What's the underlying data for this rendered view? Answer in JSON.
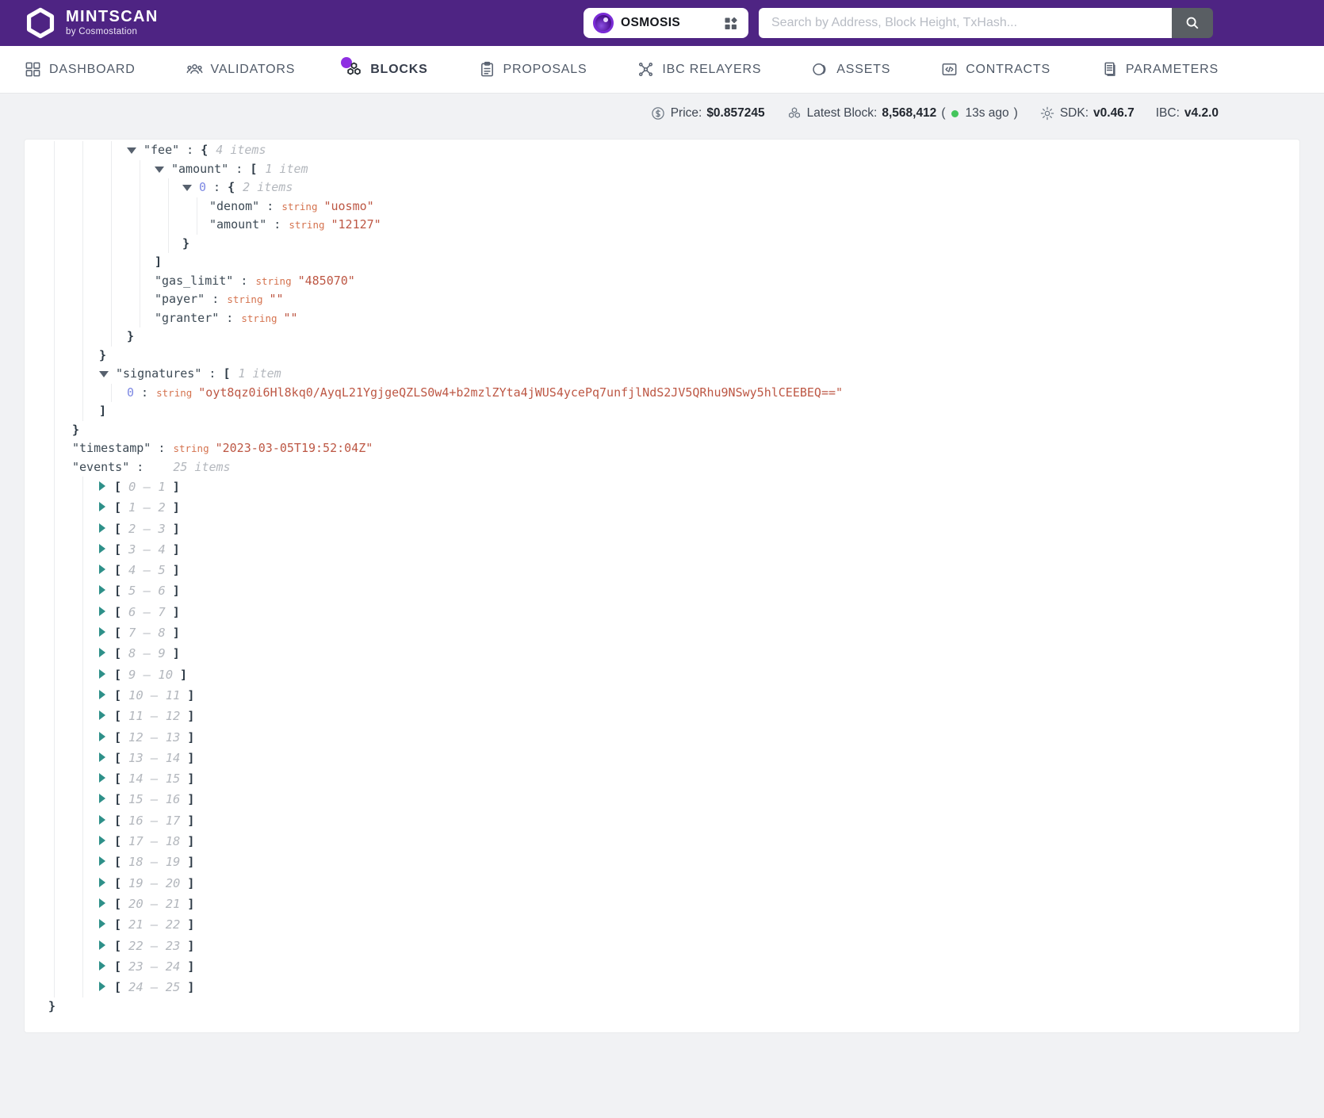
{
  "header": {
    "brand": {
      "title": "MINTSCAN",
      "subtitle": "by Cosmostation"
    },
    "chain_selector": {
      "label": "OSMOSIS"
    },
    "search": {
      "placeholder": "Search by Address, Block Height, TxHash..."
    }
  },
  "nav": {
    "items": [
      {
        "label": "DASHBOARD",
        "icon": "dashboard-icon",
        "active": false
      },
      {
        "label": "VALIDATORS",
        "icon": "validators-icon",
        "active": false
      },
      {
        "label": "BLOCKS",
        "icon": "blocks-icon",
        "active": true,
        "badge": true
      },
      {
        "label": "PROPOSALS",
        "icon": "proposals-icon",
        "active": false
      },
      {
        "label": "IBC RELAYERS",
        "icon": "ibc-relayers-icon",
        "active": false
      },
      {
        "label": "ASSETS",
        "icon": "assets-icon",
        "active": false
      },
      {
        "label": "CONTRACTS",
        "icon": "contracts-icon",
        "active": false
      },
      {
        "label": "PARAMETERS",
        "icon": "parameters-icon",
        "active": false
      }
    ]
  },
  "statusbar": {
    "price_label": "Price:",
    "price_value": "$0.857245",
    "latest_block_label": "Latest Block:",
    "latest_block_value": "8,568,412",
    "ago_prefix": "(",
    "ago_text": "13s ago",
    "ago_suffix": ")",
    "sdk_label": "SDK:",
    "sdk_value": "v0.46.7",
    "ibc_label": "IBC:",
    "ibc_value": "v4.2.0"
  },
  "colors": {
    "header_purple": "#4e2483",
    "accent_purple": "#8e2fe2",
    "green_dot": "#44c55b",
    "json_key": "#3d4a55",
    "json_value": "#bd5744",
    "json_type": "#d5734f",
    "json_index": "#7d88e3",
    "toggle_teal": "#2e9089"
  },
  "json_tree": {
    "lines": [
      {
        "lv": 3,
        "tg": "d",
        "key": "fee",
        "op": "{",
        "meta": "4 items"
      },
      {
        "lv": 4,
        "tg": "d",
        "key": "amount",
        "op": "[",
        "meta": "1 item"
      },
      {
        "lv": 5,
        "tg": "d",
        "ix": "0",
        "op": "{",
        "meta": "2 items"
      },
      {
        "lv": 6,
        "key": "denom",
        "ty": "string",
        "val": "uosmo"
      },
      {
        "lv": 6,
        "key": "amount",
        "ty": "string",
        "val": "12127"
      },
      {
        "lv": 5,
        "cl": "}"
      },
      {
        "lv": 4,
        "cl": "]"
      },
      {
        "lv": 4,
        "key": "gas_limit",
        "ty": "string",
        "val": "485070"
      },
      {
        "lv": 4,
        "key": "payer",
        "ty": "string",
        "val": ""
      },
      {
        "lv": 4,
        "key": "granter",
        "ty": "string",
        "val": ""
      },
      {
        "lv": 3,
        "cl": "}"
      },
      {
        "lv": 2,
        "cl": "}"
      },
      {
        "lv": 2,
        "tg": "d",
        "key": "signatures",
        "op": "[",
        "meta": "1 item"
      },
      {
        "lv": 3,
        "ix": "0",
        "ty": "string",
        "val": "oyt8qz0i6Hl8kq0/AyqL21YgjgeQZLS0w4+b2mzlZYta4jWUS4ycePq7unfjlNdS2JV5QRhu9NSwy5hlCEEBEQ=="
      },
      {
        "lv": 2,
        "cl": "]"
      },
      {
        "lv": 1,
        "cl": "}"
      },
      {
        "lv": 1,
        "key": "timestamp",
        "ty": "string",
        "val": "2023-03-05T19:52:04Z"
      },
      {
        "lv": 1,
        "key": "events",
        "meta": "25 items"
      },
      {
        "lv": 2,
        "tg": "r",
        "range": "0 – 1"
      },
      {
        "lv": 2,
        "tg": "r",
        "range": "1 – 2"
      },
      {
        "lv": 2,
        "tg": "r",
        "range": "2 – 3"
      },
      {
        "lv": 2,
        "tg": "r",
        "range": "3 – 4"
      },
      {
        "lv": 2,
        "tg": "r",
        "range": "4 – 5"
      },
      {
        "lv": 2,
        "tg": "r",
        "range": "5 – 6"
      },
      {
        "lv": 2,
        "tg": "r",
        "range": "6 – 7"
      },
      {
        "lv": 2,
        "tg": "r",
        "range": "7 – 8"
      },
      {
        "lv": 2,
        "tg": "r",
        "range": "8 – 9"
      },
      {
        "lv": 2,
        "tg": "r",
        "range": "9 – 10"
      },
      {
        "lv": 2,
        "tg": "r",
        "range": "10 – 11"
      },
      {
        "lv": 2,
        "tg": "r",
        "range": "11 – 12"
      },
      {
        "lv": 2,
        "tg": "r",
        "range": "12 – 13"
      },
      {
        "lv": 2,
        "tg": "r",
        "range": "13 – 14"
      },
      {
        "lv": 2,
        "tg": "r",
        "range": "14 – 15"
      },
      {
        "lv": 2,
        "tg": "r",
        "range": "15 – 16"
      },
      {
        "lv": 2,
        "tg": "r",
        "range": "16 – 17"
      },
      {
        "lv": 2,
        "tg": "r",
        "range": "17 – 18"
      },
      {
        "lv": 2,
        "tg": "r",
        "range": "18 – 19"
      },
      {
        "lv": 2,
        "tg": "r",
        "range": "19 – 20"
      },
      {
        "lv": 2,
        "tg": "r",
        "range": "20 – 21"
      },
      {
        "lv": 2,
        "tg": "r",
        "range": "21 – 22"
      },
      {
        "lv": 2,
        "tg": "r",
        "range": "22 – 23"
      },
      {
        "lv": 2,
        "tg": "r",
        "range": "23 – 24"
      },
      {
        "lv": 2,
        "tg": "r",
        "range": "24 – 25"
      },
      {
        "lv": 0,
        "cl": "}"
      }
    ]
  }
}
